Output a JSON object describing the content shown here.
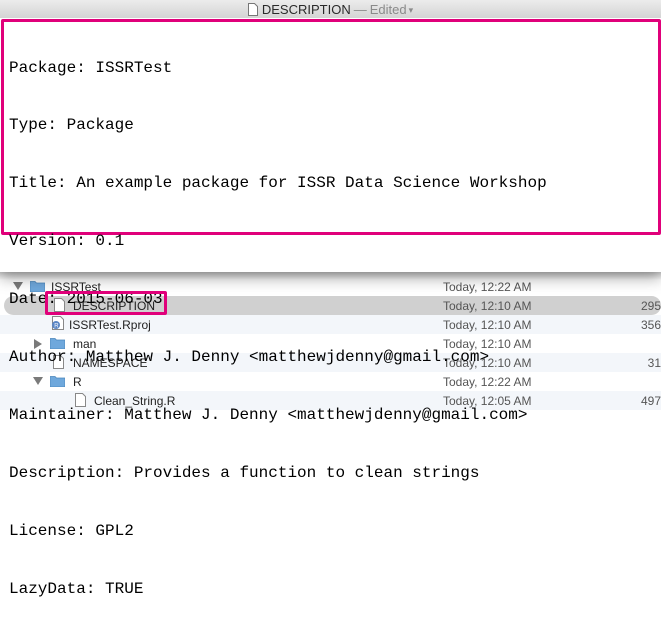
{
  "window": {
    "title": "DESCRIPTION",
    "separator": "—",
    "status": "Edited"
  },
  "editor": {
    "lines": [
      "Package: ISSRTest",
      "Type: Package",
      "Title: An example package for ISSR Data Science Workshop",
      "Version: 0.1",
      "Date: 2015-06-03",
      "Author: Matthew J. Denny <matthewjdenny@gmail.com>",
      "Maintainer: Matthew J. Denny <matthewjdenny@gmail.com>",
      "Description: Provides a function to clean strings",
      "License: GPL2",
      "LazyData: TRUE"
    ]
  },
  "finder": {
    "rows": [
      {
        "name": "ISSRTest",
        "date": "Today, 12:22 AM",
        "size": "",
        "kind": "folder",
        "icon": "folder-icon",
        "expand": "down"
      },
      {
        "name": "DESCRIPTION",
        "date": "Today, 12:10 AM",
        "size": "295",
        "kind": "file",
        "icon": "document-icon",
        "expand": ""
      },
      {
        "name": "ISSRTest.Rproj",
        "date": "Today, 12:10 AM",
        "size": "356",
        "kind": "rproj",
        "icon": "rproj-icon",
        "expand": ""
      },
      {
        "name": "man",
        "date": "Today, 12:10 AM",
        "size": "",
        "kind": "folder",
        "icon": "folder-icon",
        "expand": "right"
      },
      {
        "name": "NAMESPACE",
        "date": "Today, 12:10 AM",
        "size": "31",
        "kind": "file",
        "icon": "document-icon",
        "expand": ""
      },
      {
        "name": "R",
        "date": "Today, 12:22 AM",
        "size": "",
        "kind": "folder",
        "icon": "folder-icon",
        "expand": "down"
      },
      {
        "name": "Clean_String.R",
        "date": "Today, 12:05 AM",
        "size": "497",
        "kind": "file",
        "icon": "document-icon",
        "expand": ""
      }
    ]
  },
  "colors": {
    "highlight": "#e0007a",
    "folder": "#6fa8dc",
    "selection": "#d0d0d0"
  }
}
